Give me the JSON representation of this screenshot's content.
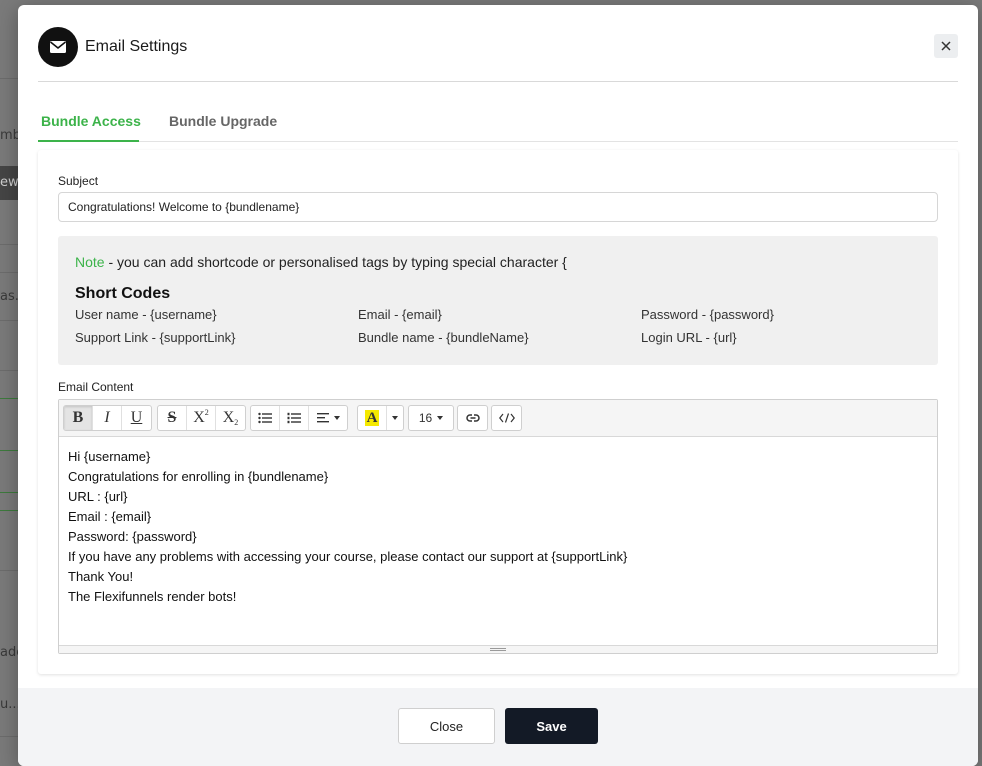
{
  "background": {
    "fragments": [
      "mb",
      "ew",
      "as...",
      "ade",
      "u..."
    ]
  },
  "modal": {
    "title": "Email Settings",
    "header_icon": "envelope-icon",
    "close_icon": "close-icon"
  },
  "tabs": [
    {
      "label": "Bundle Access",
      "active": true
    },
    {
      "label": "Bundle Upgrade",
      "active": false
    }
  ],
  "form": {
    "subject_label": "Subject",
    "subject_value": "Congratulations! Welcome to {bundlename}",
    "note_prefix": "Note",
    "note_text": " - you can add shortcode or personalised tags by typing special character {",
    "short_codes_title": "Short Codes",
    "short_codes": [
      "User name - {username}",
      "Email - {email}",
      "Password - {password}",
      "Support Link - {supportLink}",
      "Bundle name - {bundleName}",
      "Login URL - {url}"
    ],
    "email_content_label": "Email Content"
  },
  "editor": {
    "toolbar": {
      "bold": "B",
      "italic": "I",
      "underline": "U",
      "strikethrough": "S",
      "superscript": "X",
      "subscript": "X",
      "font_size": "16",
      "highlight": "A"
    },
    "lines": [
      "Hi {username}",
      "Congratulations for enrolling in {bundlename}",
      "URL : {url}",
      "Email : {email}",
      "Password: {password}",
      "If you have any problems with accessing your course, please contact our support at {supportLink}",
      "Thank You!",
      "The Flexifunnels render bots!"
    ]
  },
  "footer": {
    "close_label": "Close",
    "save_label": "Save"
  },
  "colors": {
    "accent": "#3cb34a",
    "save_bg": "#131a26",
    "highlight": "#f5e900"
  }
}
